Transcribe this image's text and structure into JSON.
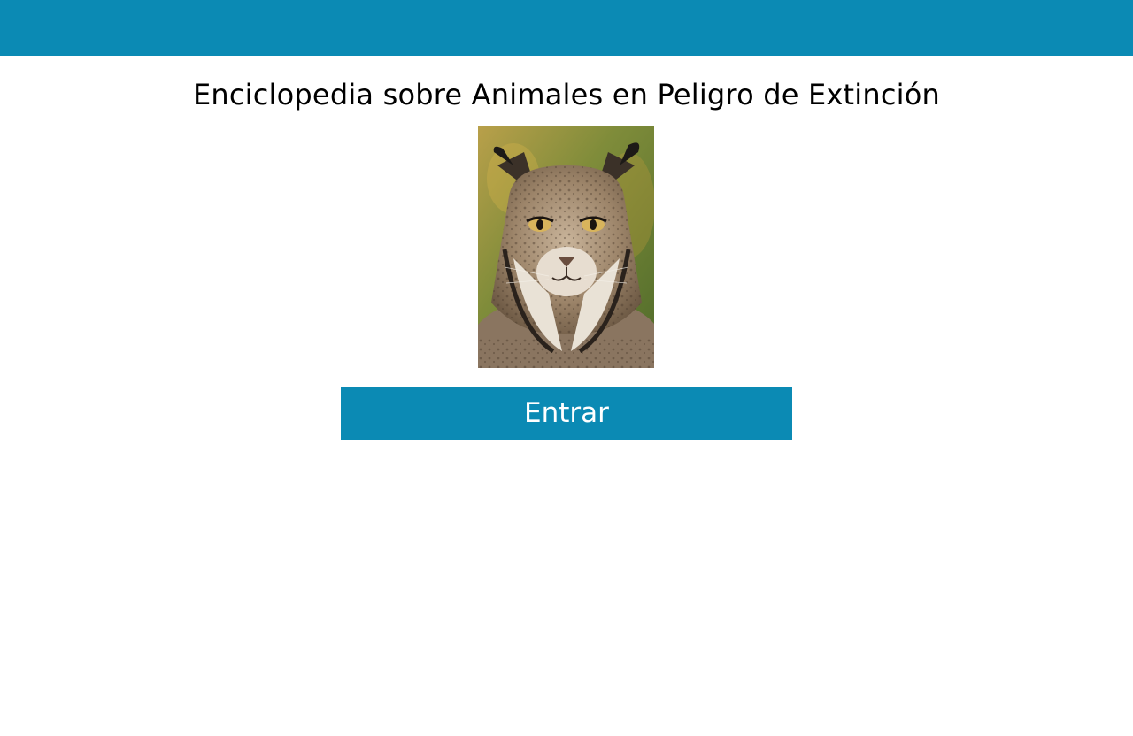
{
  "colors": {
    "primary": "#0b8ab4",
    "background": "#ffffff",
    "title_text": "#000000",
    "button_text": "#ffffff"
  },
  "header": {
    "title": "Enciclopedia sobre Animales en Peligro de Extinción"
  },
  "hero_image": {
    "alt": "Iberian lynx",
    "icon": "lynx-photo"
  },
  "actions": {
    "enter_label": "Entrar"
  }
}
